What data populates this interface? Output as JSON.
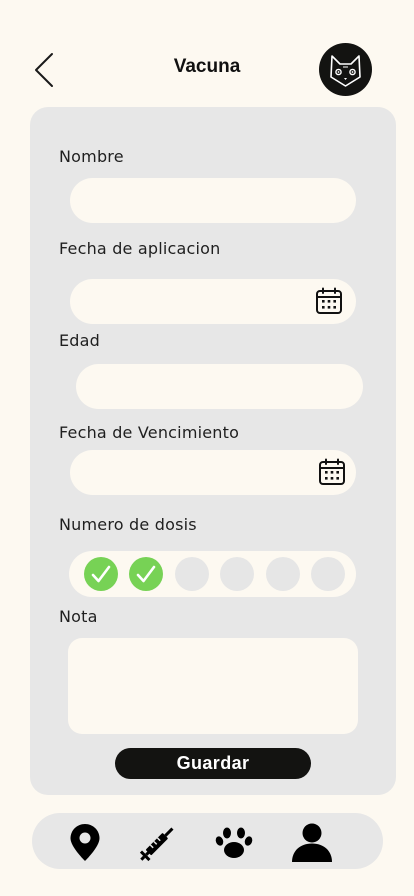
{
  "header": {
    "title": "Vacuna"
  },
  "form": {
    "nombre_label": "Nombre",
    "fecha_aplicacion_label": "Fecha de aplicacion",
    "edad_label": "Edad",
    "fecha_vencimiento_label": "Fecha de Vencimiento",
    "numero_dosis_label": "Numero de dosis",
    "nota_label": "Nota",
    "doses": [
      {
        "checked": true
      },
      {
        "checked": true
      },
      {
        "checked": false
      },
      {
        "checked": false
      },
      {
        "checked": false
      },
      {
        "checked": false
      }
    ],
    "save_label": "Guardar"
  },
  "bottom_nav": {
    "items": [
      {
        "icon": "location-pin-icon"
      },
      {
        "icon": "syringe-icon"
      },
      {
        "icon": "paw-icon"
      },
      {
        "icon": "user-icon"
      }
    ]
  },
  "colors": {
    "background": "#fdf9f1",
    "card": "#e7e7e7",
    "dark": "#131311",
    "check_green": "#77d255"
  }
}
